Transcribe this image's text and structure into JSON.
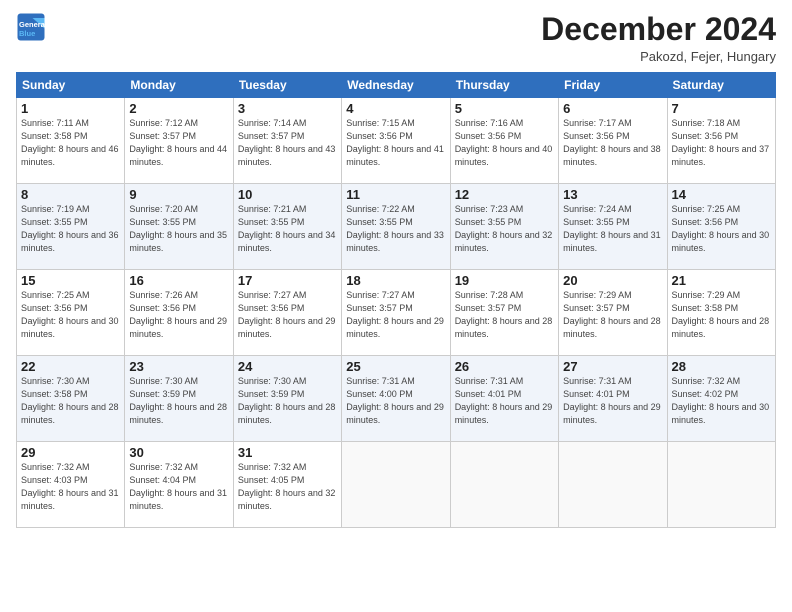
{
  "logo": {
    "line1": "General",
    "line2": "Blue"
  },
  "title": "December 2024",
  "location": "Pakozd, Fejer, Hungary",
  "days_of_week": [
    "Sunday",
    "Monday",
    "Tuesday",
    "Wednesday",
    "Thursday",
    "Friday",
    "Saturday"
  ],
  "weeks": [
    [
      {
        "day": 1,
        "sunrise": "7:11 AM",
        "sunset": "3:58 PM",
        "daylight": "8 hours and 46 minutes."
      },
      {
        "day": 2,
        "sunrise": "7:12 AM",
        "sunset": "3:57 PM",
        "daylight": "8 hours and 44 minutes."
      },
      {
        "day": 3,
        "sunrise": "7:14 AM",
        "sunset": "3:57 PM",
        "daylight": "8 hours and 43 minutes."
      },
      {
        "day": 4,
        "sunrise": "7:15 AM",
        "sunset": "3:56 PM",
        "daylight": "8 hours and 41 minutes."
      },
      {
        "day": 5,
        "sunrise": "7:16 AM",
        "sunset": "3:56 PM",
        "daylight": "8 hours and 40 minutes."
      },
      {
        "day": 6,
        "sunrise": "7:17 AM",
        "sunset": "3:56 PM",
        "daylight": "8 hours and 38 minutes."
      },
      {
        "day": 7,
        "sunrise": "7:18 AM",
        "sunset": "3:56 PM",
        "daylight": "8 hours and 37 minutes."
      }
    ],
    [
      {
        "day": 8,
        "sunrise": "7:19 AM",
        "sunset": "3:55 PM",
        "daylight": "8 hours and 36 minutes."
      },
      {
        "day": 9,
        "sunrise": "7:20 AM",
        "sunset": "3:55 PM",
        "daylight": "8 hours and 35 minutes."
      },
      {
        "day": 10,
        "sunrise": "7:21 AM",
        "sunset": "3:55 PM",
        "daylight": "8 hours and 34 minutes."
      },
      {
        "day": 11,
        "sunrise": "7:22 AM",
        "sunset": "3:55 PM",
        "daylight": "8 hours and 33 minutes."
      },
      {
        "day": 12,
        "sunrise": "7:23 AM",
        "sunset": "3:55 PM",
        "daylight": "8 hours and 32 minutes."
      },
      {
        "day": 13,
        "sunrise": "7:24 AM",
        "sunset": "3:55 PM",
        "daylight": "8 hours and 31 minutes."
      },
      {
        "day": 14,
        "sunrise": "7:25 AM",
        "sunset": "3:56 PM",
        "daylight": "8 hours and 30 minutes."
      }
    ],
    [
      {
        "day": 15,
        "sunrise": "7:25 AM",
        "sunset": "3:56 PM",
        "daylight": "8 hours and 30 minutes."
      },
      {
        "day": 16,
        "sunrise": "7:26 AM",
        "sunset": "3:56 PM",
        "daylight": "8 hours and 29 minutes."
      },
      {
        "day": 17,
        "sunrise": "7:27 AM",
        "sunset": "3:56 PM",
        "daylight": "8 hours and 29 minutes."
      },
      {
        "day": 18,
        "sunrise": "7:27 AM",
        "sunset": "3:57 PM",
        "daylight": "8 hours and 29 minutes."
      },
      {
        "day": 19,
        "sunrise": "7:28 AM",
        "sunset": "3:57 PM",
        "daylight": "8 hours and 28 minutes."
      },
      {
        "day": 20,
        "sunrise": "7:29 AM",
        "sunset": "3:57 PM",
        "daylight": "8 hours and 28 minutes."
      },
      {
        "day": 21,
        "sunrise": "7:29 AM",
        "sunset": "3:58 PM",
        "daylight": "8 hours and 28 minutes."
      }
    ],
    [
      {
        "day": 22,
        "sunrise": "7:30 AM",
        "sunset": "3:58 PM",
        "daylight": "8 hours and 28 minutes."
      },
      {
        "day": 23,
        "sunrise": "7:30 AM",
        "sunset": "3:59 PM",
        "daylight": "8 hours and 28 minutes."
      },
      {
        "day": 24,
        "sunrise": "7:30 AM",
        "sunset": "3:59 PM",
        "daylight": "8 hours and 28 minutes."
      },
      {
        "day": 25,
        "sunrise": "7:31 AM",
        "sunset": "4:00 PM",
        "daylight": "8 hours and 29 minutes."
      },
      {
        "day": 26,
        "sunrise": "7:31 AM",
        "sunset": "4:01 PM",
        "daylight": "8 hours and 29 minutes."
      },
      {
        "day": 27,
        "sunrise": "7:31 AM",
        "sunset": "4:01 PM",
        "daylight": "8 hours and 29 minutes."
      },
      {
        "day": 28,
        "sunrise": "7:32 AM",
        "sunset": "4:02 PM",
        "daylight": "8 hours and 30 minutes."
      }
    ],
    [
      {
        "day": 29,
        "sunrise": "7:32 AM",
        "sunset": "4:03 PM",
        "daylight": "8 hours and 31 minutes."
      },
      {
        "day": 30,
        "sunrise": "7:32 AM",
        "sunset": "4:04 PM",
        "daylight": "8 hours and 31 minutes."
      },
      {
        "day": 31,
        "sunrise": "7:32 AM",
        "sunset": "4:05 PM",
        "daylight": "8 hours and 32 minutes."
      },
      null,
      null,
      null,
      null
    ]
  ]
}
